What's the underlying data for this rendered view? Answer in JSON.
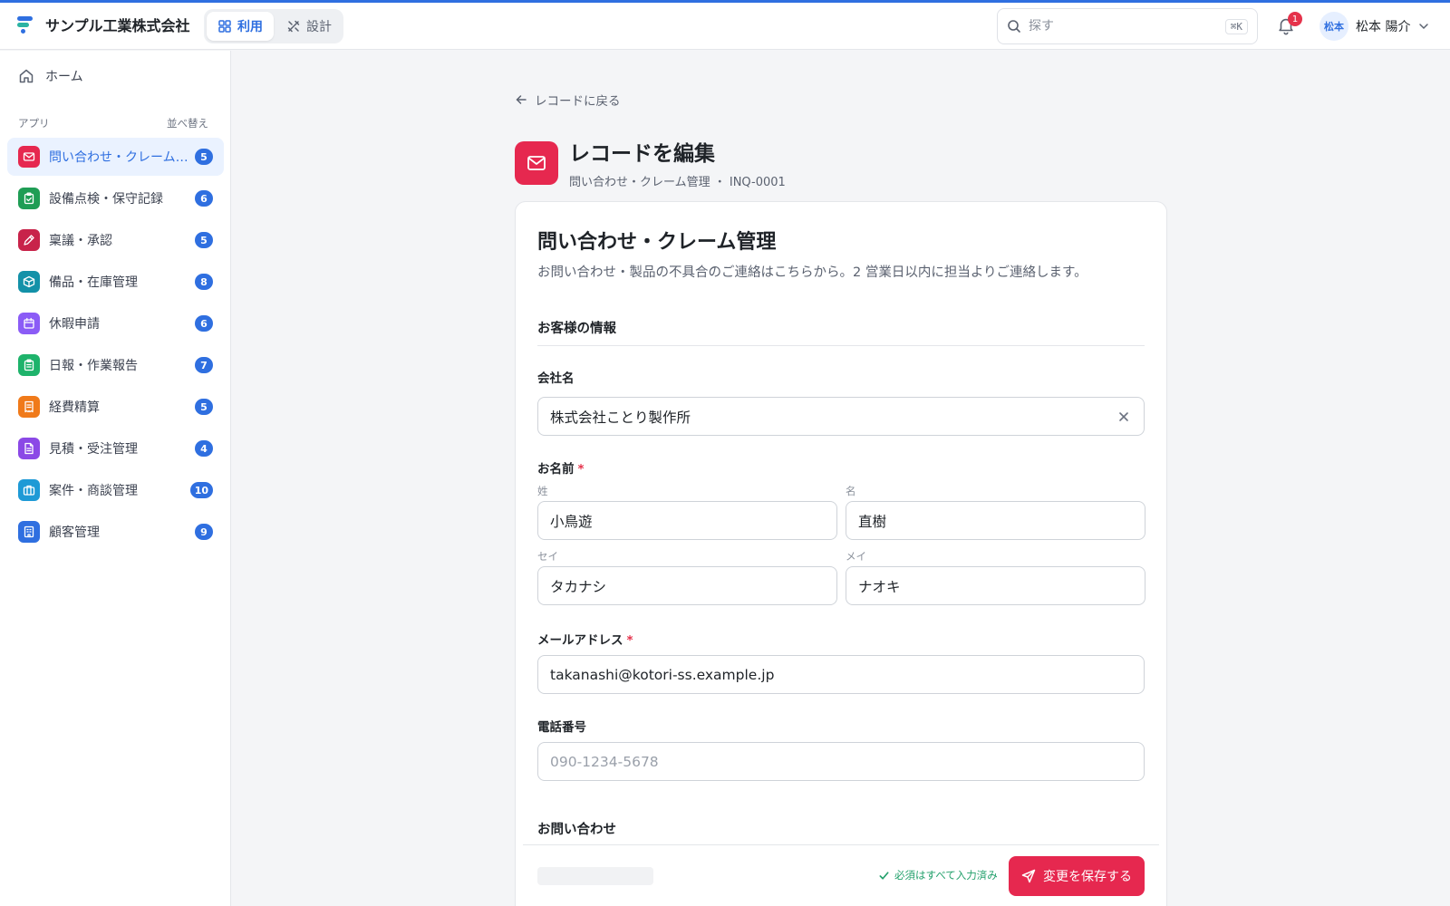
{
  "brand": {
    "name": "サンプル工業株式会社"
  },
  "mode": {
    "use_label": "利用",
    "design_label": "設計"
  },
  "search": {
    "placeholder": "探す",
    "shortcut": "⌘K"
  },
  "notifications": {
    "count": "1"
  },
  "user": {
    "avatar_text": "松本",
    "name": "松本 陽介"
  },
  "sidebar": {
    "home_label": "ホーム",
    "apps_heading": "アプリ",
    "sort_label": "並べ替え",
    "items": [
      {
        "label": "問い合わせ・クレーム管理",
        "count": "5",
        "color": "#e6284f",
        "icon": "mail-icon"
      },
      {
        "label": "設備点検・保守記録",
        "count": "6",
        "color": "#1f9d55",
        "icon": "clipboard-check-icon"
      },
      {
        "label": "稟議・承認",
        "count": "5",
        "color": "#c8234a",
        "icon": "pen-icon"
      },
      {
        "label": "備品・在庫管理",
        "count": "8",
        "color": "#1391a8",
        "icon": "box-icon"
      },
      {
        "label": "休暇申請",
        "count": "6",
        "color": "#8b5cf6",
        "icon": "calendar-icon"
      },
      {
        "label": "日報・作業報告",
        "count": "7",
        "color": "#1eb36b",
        "icon": "clipboard-list-icon"
      },
      {
        "label": "経費精算",
        "count": "5",
        "color": "#f07a1a",
        "icon": "receipt-icon"
      },
      {
        "label": "見積・受注管理",
        "count": "4",
        "color": "#8b49e6",
        "icon": "document-icon"
      },
      {
        "label": "案件・商談管理",
        "count": "10",
        "color": "#1e9ad6",
        "icon": "briefcase-icon"
      },
      {
        "label": "顧客管理",
        "count": "9",
        "color": "#2f6fe0",
        "icon": "building-icon"
      }
    ]
  },
  "main": {
    "back_label": "レコードに戻る",
    "title": "レコードを編集",
    "subtitle": "問い合わせ・クレーム管理 ・ INQ-0001",
    "form": {
      "title": "問い合わせ・クレーム管理",
      "description": "お問い合わせ・製品の不具合のご連絡はこちらから。2 営業日以内に担当よりご連絡します。",
      "section_customer": "お客様の情報",
      "company_label": "会社名",
      "company_value": "株式会社ことり製作所",
      "name_label": "お名前",
      "required_mark": "*",
      "last_name_label": "姓",
      "last_name_value": "小鳥遊",
      "first_name_label": "名",
      "first_name_value": "直樹",
      "last_kana_label": "セイ",
      "last_kana_value": "タカナシ",
      "first_kana_label": "メイ",
      "first_kana_value": "ナオキ",
      "email_label": "メールアドレス",
      "email_value": "takanashi@kotori-ss.example.jp",
      "phone_label": "電話番号",
      "phone_placeholder": "090-1234-5678",
      "section_inquiry": "お問い合わせ"
    },
    "footer": {
      "status": "必須はすべて入力済み",
      "save_label": "変更を保存する"
    }
  }
}
